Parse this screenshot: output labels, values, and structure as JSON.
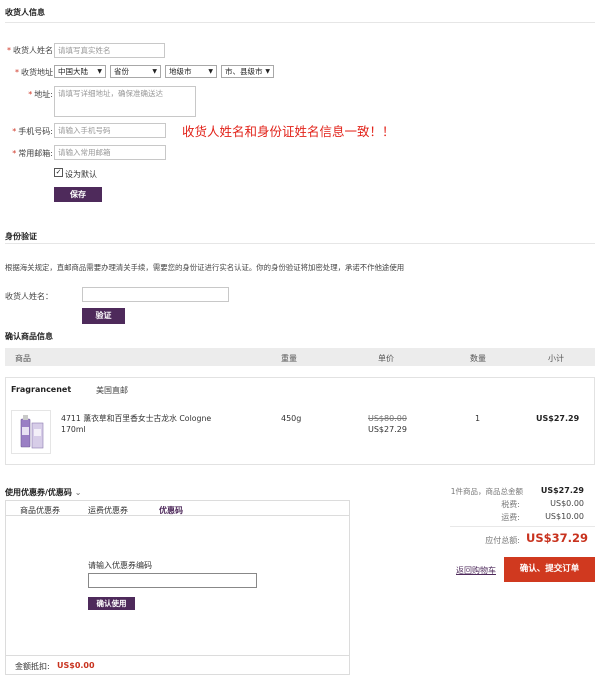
{
  "receiver": {
    "section_title": "收货人信息",
    "name_label": "收货人姓名",
    "name_placeholder": "请填写真实姓名",
    "address_area_label": "收货地址",
    "country": "中国大陆",
    "province": "省份",
    "city": "地级市",
    "district": "市、县级市",
    "address_label": "地址",
    "address_placeholder": "请填写详细地址，确保准确送达",
    "phone_label": "手机号码",
    "phone_placeholder": "请输入手机号码",
    "email_label": "常用邮箱",
    "email_placeholder": "请输入常用邮箱",
    "default_label": "设为默认",
    "default_checked": true,
    "save_button": "保存",
    "notice": "收货人姓名和身份证姓名信息一致！！"
  },
  "identity": {
    "section_title": "身份验证",
    "description": "根据海关规定，直邮商品需要办理清关手续，需要您的身份证进行实名认证。你的身份验证将加密处理，承诺不作他途使用",
    "name_label": "收货人姓名：",
    "verify_button": "验证"
  },
  "goods": {
    "section_title": "确认商品信息",
    "headers": {
      "product": "商品",
      "weight": "重量",
      "unit_price": "单价",
      "quantity": "数量",
      "subtotal": "小计"
    },
    "seller": "Fragrancenet",
    "shipping_method": "美国直邮",
    "item": {
      "name": "4711 薰衣草和百里香女士古龙水 Cologne 170ml",
      "weight": "450g",
      "original_price": "US$80.00",
      "price": "US$27.29",
      "quantity": "1",
      "subtotal": "US$27.29"
    }
  },
  "coupon": {
    "title": "使用优惠券/优惠码",
    "tabs": [
      "商品优惠券",
      "运费优惠券",
      "优惠码"
    ],
    "active_tab": 2,
    "code_label": "请输入优惠券编码",
    "apply_button": "确认使用",
    "discount_label": "金额抵扣:",
    "discount_value": "US$0.00"
  },
  "summary": {
    "goods_total_label": "1件商品，商品总金额",
    "goods_total": "US$27.29",
    "tax_label": "税费:",
    "tax": "US$0.00",
    "shipping_label": "运费:",
    "shipping": "US$10.00",
    "total_label": "应付总额:",
    "total": "US$37.29",
    "back_link": "返回购物车",
    "submit_button": "确认、提交订单"
  },
  "colors": {
    "accent": "#4e2a5b",
    "submit": "#d0391f",
    "price": "#c8321e",
    "notice": "#e2231a"
  }
}
